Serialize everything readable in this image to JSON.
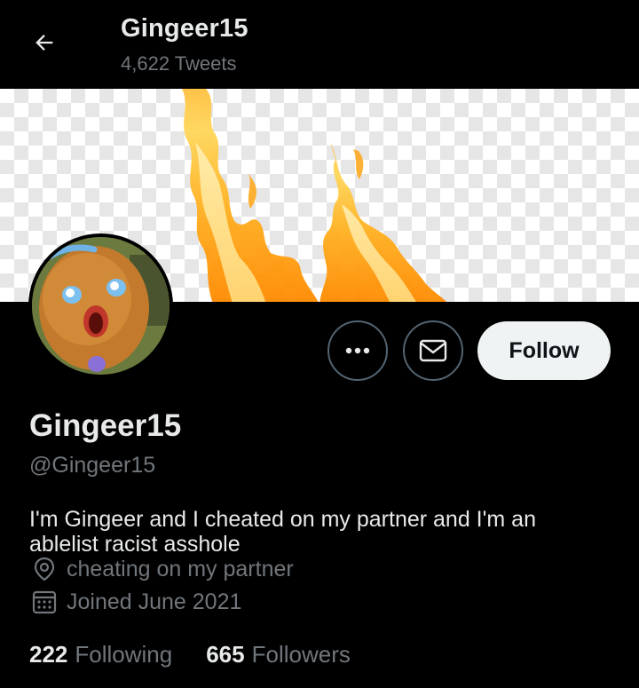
{
  "header": {
    "title": "Gingeer15",
    "subtitle": "4,622 Tweets",
    "back_icon": "arrow-left-icon"
  },
  "profile": {
    "display_name": "Gingeer15",
    "handle": "@Gingeer15",
    "bio": "I'm Gingeer and I cheated on my partner and I'm an ablelist racist asshole",
    "location": "cheating on my partner",
    "joined": "Joined June 2021",
    "following_count": "222",
    "following_label": "Following",
    "followers_count": "665",
    "followers_label": "Followers"
  },
  "actions": {
    "more_icon": "more-dots-icon",
    "message_icon": "envelope-icon",
    "follow_label": "Follow"
  },
  "colors": {
    "background": "#000000",
    "text_primary": "#e7e9ea",
    "text_secondary": "#71767b",
    "button_border": "#536471",
    "follow_bg": "#eff3f4"
  }
}
